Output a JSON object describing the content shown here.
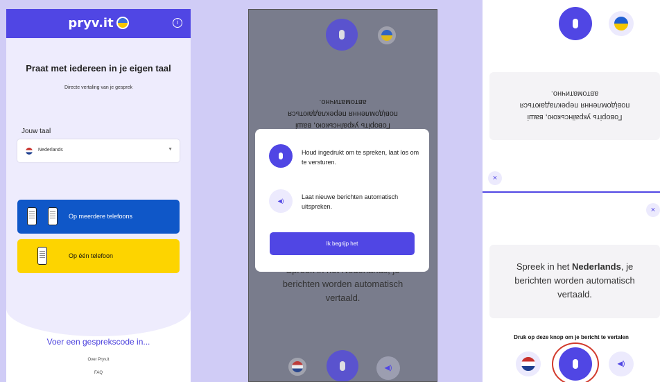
{
  "screen1": {
    "logo": "pryv.it",
    "title": "Praat met iedereen in je eigen taal",
    "subtitle": "Directe vertaling van je gesprek",
    "language_label": "Jouw taal",
    "language_value": "Nederlands",
    "multi_phone_button": "Op meerdere telefoons",
    "single_phone_button": "Op één telefoon",
    "enter_code_link": "Voer een gesprekscode in...",
    "about_link": "Over Pryv.it",
    "faq_link": "FAQ"
  },
  "screen2": {
    "top_message_lines": [
      "Говоріть українською, ваші",
      "повідомлення перекладаються",
      "автоматично."
    ],
    "bottom_message_lines": [
      "Spreek in het Nederlands, je",
      "berichten worden automatisch",
      "vertaald."
    ],
    "modal": {
      "hold_text": "Houd ingedrukt om te spreken, laat los om te versturen.",
      "speak_text": "Laat nieuwe berichten automatisch uitspreken.",
      "ok_button": "Ik begrijp het"
    }
  },
  "screen3": {
    "top_message_lines": [
      "Говоріть українською, ваші",
      "повідомлення перекладаються",
      "автоматично."
    ],
    "bottom_message_pre": "Spreek in het ",
    "bottom_message_bold": "Nederlands",
    "bottom_message_post": ", je",
    "bottom_message_line2": "berichten worden automatisch",
    "bottom_message_line3": "vertaald.",
    "hint": "Druk op deze knop om je bericht te vertalen",
    "close_glyph": "×"
  },
  "colors": {
    "accent": "#5046e4",
    "background": "#d0ccf6",
    "blue_button": "#0f57c8",
    "yellow_button": "#fdd400",
    "highlight_ring": "#d23a2c"
  }
}
